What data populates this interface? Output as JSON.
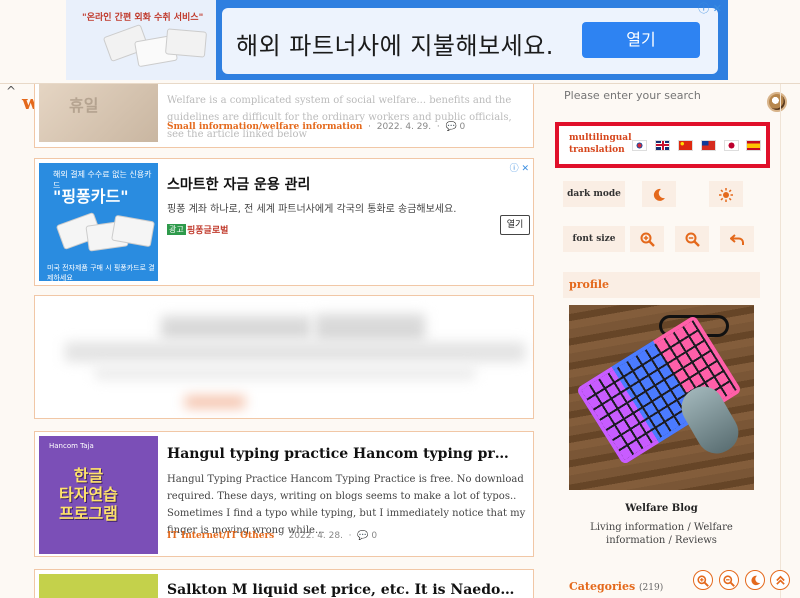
{
  "top_ad": {
    "thumb_tag": "\"온라인 간편 외화 수취 서비스\"",
    "headline": "해외 파트너사에 지불해보세요.",
    "open_label": "열기",
    "choices": "ⓘ ✕"
  },
  "header": {
    "collapse": "^",
    "title": "welfare",
    "search_placeholder": "Please enter your search"
  },
  "posts": [
    {
      "thumb_text": "휴일",
      "excerpt": "Welfare is a complicated system of social welfare... benefits and the guidelines are difficult for the ordinary workers and public officials, see the article linked below",
      "category": "Small information/welfare information",
      "date": "2022. 4. 29.",
      "comments": "0"
    },
    {
      "thumb_top": "해외 결제 수수료 없는 신용카드",
      "thumb_brand": "\"핑퐁카드\"",
      "thumb_bottom": "미국 전자제품 구매 시 핑퐁카드로 결제하세요",
      "headline": "스마트한 자금 운용 관리",
      "desc": "핑퐁 계좌 하나로, 전 세계 파트너사에게 각국의 통화로 송금해보세요.",
      "ad_label": "광고",
      "advertiser": "핑퐁글로벌",
      "open_label": "열기",
      "ad_x": "ⓘ ✕"
    },
    {
      "thumb_top": "Hancom Taja",
      "thumb_title": "한글\n타자연습\n프로그램",
      "title": "Hangul typing practice Hancom typing practice is free. No download required",
      "excerpt": "Hangul Typing Practice Hancom Typing Practice is free. No download required. These days, writing on blogs seems to make a lot of typos.. Sometimes I find a typo while typing, but I immediately notice that my finger is moving wrong while...",
      "category": "IT Internet/IT Others",
      "date": "2022. 4. 28.",
      "comments": "0"
    },
    {
      "title": "Salkton M liquid set price, etc. It is Naedonnaesan"
    }
  ],
  "sidebar": {
    "multilingual_label": "multilingual translation",
    "languages": [
      "Korean",
      "English",
      "Chinese",
      "Taiwanese",
      "Japanese",
      "Spanish"
    ],
    "dark_mode_label": "dark mode",
    "font_size_label": "font size",
    "profile_heading": "profile",
    "profile_name": "Welfare Blog",
    "profile_desc": "Living information / Welfare information / Reviews",
    "categories_label": "Categories",
    "categories_count": "(219)"
  },
  "colors": {
    "accent": "#e4691c",
    "highlight_border": "#e0102a",
    "ad_blue": "#2e83f2",
    "card_border": "#f1c7a6",
    "sidebar_tile": "#faeee4"
  }
}
